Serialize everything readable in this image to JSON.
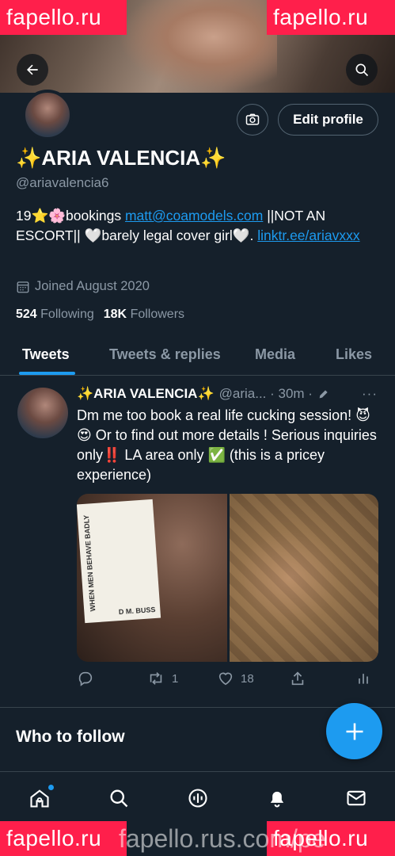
{
  "banner": {
    "watermark_text": "fapello.ru",
    "watermark_url": "fapello.rus.com/pe"
  },
  "header": {
    "edit_profile_label": "Edit profile"
  },
  "profile": {
    "name": "✨ARIA VALENCIA✨",
    "handle": "@ariavalencia6",
    "bio_prefix": "19⭐🌸bookings ",
    "bio_email": "matt@coamodels.com",
    "bio_middle": " ||NOT AN ESCORT|| 🤍barely legal cover girl🤍. ",
    "bio_link": "linktr.ee/ariavxxx",
    "joined": "Joined August 2020",
    "following_count": "524",
    "following_label": "Following",
    "followers_count": "18K",
    "followers_label": "Followers"
  },
  "tabs": [
    {
      "label": "Tweets",
      "active": true
    },
    {
      "label": "Tweets & replies",
      "active": false
    },
    {
      "label": "Media",
      "active": false
    },
    {
      "label": "Likes",
      "active": false
    }
  ],
  "tweet": {
    "name": "✨ARIA VALENCIA✨",
    "handle_time": "@aria... · 30m ·",
    "more": "···",
    "text": "Dm me too book a real life cucking session! 😈😍 Or to find out more details ! Serious inquiries only‼️ LA area only ✅ (this is a pricey experience)",
    "book_title": "WHEN MEN BEHAVE BADLY",
    "book_author": "D M. BUSS",
    "retweets": "1",
    "likes": "18"
  },
  "who_to_follow": "Who to follow",
  "colors": {
    "background": "#15202b",
    "accent": "#1d9bf0",
    "muted": "#8b98a5",
    "divider": "#38444d",
    "watermark": "#ff1f4b"
  },
  "icons": [
    "back-arrow-icon",
    "search-icon",
    "camera-icon",
    "calendar-icon",
    "edit-pen-icon",
    "reply-icon",
    "retweet-icon",
    "like-icon",
    "share-icon",
    "analytics-icon",
    "plus-icon",
    "home-icon",
    "explore-icon",
    "spaces-icon",
    "notifications-icon",
    "messages-icon"
  ]
}
